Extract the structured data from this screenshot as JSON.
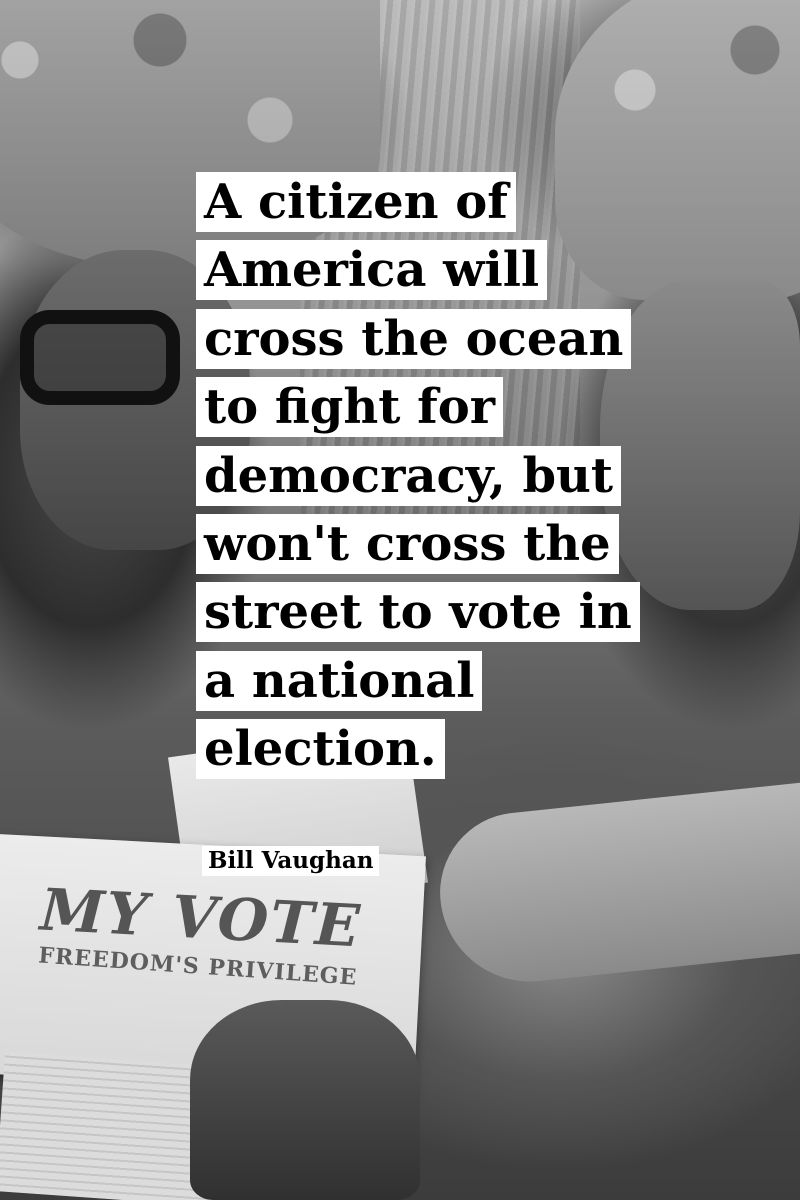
{
  "quote": {
    "lines": [
      "A citizen of",
      "America will",
      "cross the ocean",
      "to fight for",
      "democracy, but",
      "won't cross the",
      "street to vote in",
      "a national",
      "election."
    ],
    "author": "Bill Vaughan"
  },
  "photo": {
    "pamphlet_title": "MY VOTE",
    "pamphlet_subtitle": "FREEDOM'S PRIVILEGE"
  },
  "colors": {
    "text_bg": "#ffffff",
    "text": "#000000"
  }
}
